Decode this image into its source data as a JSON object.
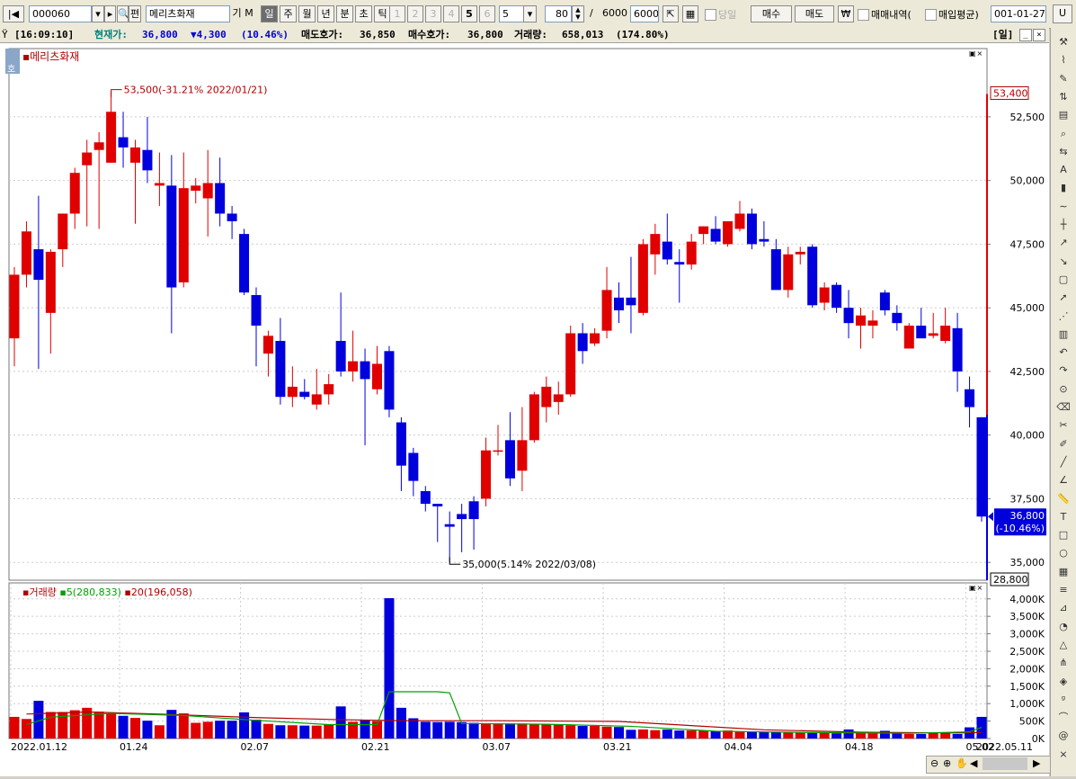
{
  "toolbar": {
    "code": "000060",
    "name": "메리츠화재",
    "btn_gi": "기",
    "btn_m": "M",
    "periods": [
      "일",
      "주",
      "월",
      "년",
      "분",
      "초",
      "틱"
    ],
    "selected_period": "일",
    "nums": [
      "1",
      "2",
      "3",
      "4",
      "5",
      "6"
    ],
    "minute_select": "5",
    "count": "80",
    "slash": "/",
    "total": "6000",
    "total_box": "6000",
    "today_label": "당일",
    "buy": "매수",
    "sell": "매도",
    "won": "₩",
    "trade_history": "매매내역(",
    "avg_price": "매입평균)",
    "date": "001-01-27"
  },
  "status": {
    "time": "[16:09:10]",
    "price_label": "현재가:",
    "price": "36,800",
    "change": "▼4,300",
    "change_pct": "(10.46%)",
    "ask_label": "매도호가:",
    "ask": "36,850",
    "bid_label": "매수호가:",
    "bid": "36,800",
    "vol_label": "거래량:",
    "volume": "658,013",
    "vol_pct": "(174.80%)",
    "period_tag": "[일]"
  },
  "chart": {
    "title": "메리츠화재",
    "tag": "호",
    "high_note": "53,500(-31.21% 2022/01/21)",
    "low_note": "35,000(5.14% 2022/03/08)",
    "max_box": "53,400",
    "min_box": "28,800",
    "current_box": "36,800",
    "current_pct": "(-10.46%)",
    "price_ticks": [
      "52,500",
      "50,000",
      "47,500",
      "45,000",
      "42,500",
      "40,000",
      "37,500",
      "35,000"
    ],
    "vol_title": "거래량",
    "ma5_label": "5(280,833)",
    "ma20_label": "20(196,058)",
    "vol_ticks": [
      "4,000K",
      "3,500K",
      "3,000K",
      "2,500K",
      "2,000K",
      "1,500K",
      "1,000K",
      "500K",
      "0K"
    ],
    "date_ticks": [
      "2022.01.12",
      "01.24",
      "02.07",
      "02.21",
      "03.07",
      "03.21",
      "04.04",
      "04.18",
      "05.02",
      "2022.05.11"
    ],
    "colors": {
      "up": "#e00000",
      "down": "#0000dd",
      "ma5": "#00a000",
      "ma20": "#b00000"
    }
  },
  "chart_data": {
    "type": "candlestick",
    "candles": [
      {
        "o": 43800,
        "h": 46600,
        "l": 42700,
        "c": 46300
      },
      {
        "o": 46300,
        "h": 48400,
        "l": 45800,
        "c": 48000
      },
      {
        "o": 47300,
        "h": 49400,
        "l": 42600,
        "c": 46100
      },
      {
        "o": 44800,
        "h": 47300,
        "l": 43200,
        "c": 47200
      },
      {
        "o": 47300,
        "h": 48600,
        "l": 46600,
        "c": 48700
      },
      {
        "o": 48700,
        "h": 50500,
        "l": 48100,
        "c": 50300
      },
      {
        "o": 50600,
        "h": 51600,
        "l": 48200,
        "c": 51100
      },
      {
        "o": 51200,
        "h": 51900,
        "l": 48100,
        "c": 51500
      },
      {
        "o": 50700,
        "h": 53500,
        "l": 50700,
        "c": 52700
      },
      {
        "o": 51700,
        "h": 52700,
        "l": 50500,
        "c": 51300
      },
      {
        "o": 50700,
        "h": 51600,
        "l": 48300,
        "c": 51300
      },
      {
        "o": 51200,
        "h": 52500,
        "l": 49900,
        "c": 50400
      },
      {
        "o": 49800,
        "h": 51100,
        "l": 49000,
        "c": 49900
      },
      {
        "o": 49800,
        "h": 51000,
        "l": 44000,
        "c": 45800
      },
      {
        "o": 46000,
        "h": 51100,
        "l": 45800,
        "c": 49700
      },
      {
        "o": 49600,
        "h": 50100,
        "l": 49100,
        "c": 49800
      },
      {
        "o": 49300,
        "h": 51200,
        "l": 47800,
        "c": 49900
      },
      {
        "o": 49900,
        "h": 50900,
        "l": 48200,
        "c": 48700
      },
      {
        "o": 48700,
        "h": 49000,
        "l": 47700,
        "c": 48400
      },
      {
        "o": 47900,
        "h": 48100,
        "l": 45500,
        "c": 45600
      },
      {
        "o": 45500,
        "h": 45800,
        "l": 42700,
        "c": 44300
      },
      {
        "o": 43200,
        "h": 44100,
        "l": 42300,
        "c": 43900
      },
      {
        "o": 43700,
        "h": 44600,
        "l": 41200,
        "c": 41500
      },
      {
        "o": 41500,
        "h": 42700,
        "l": 41100,
        "c": 41900
      },
      {
        "o": 41700,
        "h": 42200,
        "l": 41400,
        "c": 41500
      },
      {
        "o": 41200,
        "h": 42600,
        "l": 41000,
        "c": 41600
      },
      {
        "o": 41600,
        "h": 42400,
        "l": 41200,
        "c": 42000
      },
      {
        "o": 43700,
        "h": 45600,
        "l": 42300,
        "c": 42500
      },
      {
        "o": 42500,
        "h": 44100,
        "l": 42100,
        "c": 42900
      },
      {
        "o": 42900,
        "h": 43400,
        "l": 39600,
        "c": 42200
      },
      {
        "o": 41800,
        "h": 43500,
        "l": 41600,
        "c": 42800
      },
      {
        "o": 43300,
        "h": 43500,
        "l": 40700,
        "c": 41000
      },
      {
        "o": 40500,
        "h": 40700,
        "l": 37800,
        "c": 38800
      },
      {
        "o": 39300,
        "h": 39500,
        "l": 37600,
        "c": 38200
      },
      {
        "o": 37800,
        "h": 38000,
        "l": 37000,
        "c": 37300
      },
      {
        "o": 37300,
        "h": 37300,
        "l": 35800,
        "c": 37200
      },
      {
        "o": 36500,
        "h": 37000,
        "l": 35000,
        "c": 36400
      },
      {
        "o": 36900,
        "h": 37300,
        "l": 35400,
        "c": 36700
      },
      {
        "o": 37400,
        "h": 37600,
        "l": 35500,
        "c": 36700
      },
      {
        "o": 37500,
        "h": 39900,
        "l": 37200,
        "c": 39400
      },
      {
        "o": 39400,
        "h": 40400,
        "l": 39200,
        "c": 39400
      },
      {
        "o": 39800,
        "h": 40900,
        "l": 38000,
        "c": 38300
      },
      {
        "o": 38600,
        "h": 41100,
        "l": 37800,
        "c": 39800
      },
      {
        "o": 39800,
        "h": 41700,
        "l": 39700,
        "c": 41600
      },
      {
        "o": 41100,
        "h": 42300,
        "l": 40500,
        "c": 41900
      },
      {
        "o": 41300,
        "h": 42100,
        "l": 40800,
        "c": 41600
      },
      {
        "o": 41600,
        "h": 44300,
        "l": 41500,
        "c": 44000
      },
      {
        "o": 44000,
        "h": 44400,
        "l": 42800,
        "c": 43300
      },
      {
        "o": 43600,
        "h": 44200,
        "l": 43500,
        "c": 44000
      },
      {
        "o": 44100,
        "h": 46600,
        "l": 43800,
        "c": 45700
      },
      {
        "o": 45400,
        "h": 46000,
        "l": 44400,
        "c": 44900
      },
      {
        "o": 45400,
        "h": 47000,
        "l": 44000,
        "c": 45100
      },
      {
        "o": 44800,
        "h": 47700,
        "l": 44700,
        "c": 47500
      },
      {
        "o": 47100,
        "h": 48300,
        "l": 46300,
        "c": 47900
      },
      {
        "o": 47600,
        "h": 48700,
        "l": 46700,
        "c": 46900
      },
      {
        "o": 46800,
        "h": 47300,
        "l": 45200,
        "c": 46700
      },
      {
        "o": 46700,
        "h": 47900,
        "l": 46500,
        "c": 47600
      },
      {
        "o": 47900,
        "h": 48200,
        "l": 47500,
        "c": 48200
      },
      {
        "o": 48100,
        "h": 48600,
        "l": 47500,
        "c": 47600
      },
      {
        "o": 47500,
        "h": 48300,
        "l": 47400,
        "c": 48400
      },
      {
        "o": 48100,
        "h": 49200,
        "l": 48000,
        "c": 48700
      },
      {
        "o": 48700,
        "h": 48900,
        "l": 47300,
        "c": 47500
      },
      {
        "o": 47700,
        "h": 48400,
        "l": 47400,
        "c": 47600
      },
      {
        "o": 47300,
        "h": 47700,
        "l": 45900,
        "c": 45700
      },
      {
        "o": 45700,
        "h": 47400,
        "l": 45400,
        "c": 47100
      },
      {
        "o": 47100,
        "h": 47400,
        "l": 46700,
        "c": 47200
      },
      {
        "o": 47400,
        "h": 47500,
        "l": 45000,
        "c": 45100
      },
      {
        "o": 45200,
        "h": 46000,
        "l": 44900,
        "c": 45800
      },
      {
        "o": 45900,
        "h": 46000,
        "l": 44800,
        "c": 45000
      },
      {
        "o": 45000,
        "h": 45700,
        "l": 43800,
        "c": 44400
      },
      {
        "o": 44300,
        "h": 45000,
        "l": 43400,
        "c": 44700
      },
      {
        "o": 44300,
        "h": 44900,
        "l": 43800,
        "c": 44500
      },
      {
        "o": 45600,
        "h": 45700,
        "l": 44700,
        "c": 44900
      },
      {
        "o": 44800,
        "h": 45100,
        "l": 44100,
        "c": 44400
      },
      {
        "o": 43400,
        "h": 44400,
        "l": 43400,
        "c": 44300
      },
      {
        "o": 44300,
        "h": 45000,
        "l": 43900,
        "c": 43800
      },
      {
        "o": 43900,
        "h": 44800,
        "l": 43800,
        "c": 44000
      },
      {
        "o": 43700,
        "h": 45000,
        "l": 43600,
        "c": 44300
      },
      {
        "o": 44200,
        "h": 44800,
        "l": 41700,
        "c": 42500
      },
      {
        "o": 41800,
        "h": 42300,
        "l": 40300,
        "c": 41100
      },
      {
        "o": 40700,
        "h": 40700,
        "l": 36600,
        "c": 36800
      }
    ],
    "volume_k": [
      620,
      560,
      1080,
      760,
      760,
      810,
      880,
      770,
      720,
      650,
      590,
      510,
      380,
      820,
      720,
      450,
      480,
      510,
      510,
      750,
      540,
      420,
      380,
      380,
      370,
      370,
      400,
      920,
      480,
      520,
      500,
      4020,
      880,
      580,
      480,
      470,
      480,
      470,
      450,
      440,
      430,
      430,
      430,
      420,
      410,
      400,
      380,
      360,
      360,
      340,
      330,
      250,
      260,
      240,
      260,
      230,
      230,
      220,
      210,
      230,
      200,
      190,
      190,
      180,
      170,
      180,
      170,
      160,
      150,
      260,
      160,
      150,
      220,
      150,
      130,
      130,
      170,
      170,
      130,
      320,
      620
    ],
    "ma5_k": [
      [
        1,
        400
      ],
      [
        3,
        610
      ],
      [
        8,
        720
      ],
      [
        14,
        660
      ],
      [
        20,
        520
      ],
      [
        26,
        400
      ],
      [
        30,
        400
      ],
      [
        31,
        1340
      ],
      [
        35,
        1340
      ],
      [
        36,
        1310
      ],
      [
        37,
        430
      ],
      [
        44,
        410
      ],
      [
        51,
        350
      ],
      [
        58,
        210
      ],
      [
        66,
        170
      ],
      [
        74,
        150
      ],
      [
        79,
        190
      ],
      [
        80,
        320
      ]
    ],
    "ma20_k": [
      [
        1,
        700
      ],
      [
        6,
        760
      ],
      [
        12,
        700
      ],
      [
        20,
        600
      ],
      [
        27,
        540
      ],
      [
        32,
        510
      ],
      [
        40,
        510
      ],
      [
        50,
        490
      ],
      [
        62,
        250
      ],
      [
        70,
        180
      ],
      [
        78,
        160
      ],
      [
        80,
        170
      ]
    ],
    "price_range": [
      34300,
      54900
    ],
    "volume_range_k": [
      0,
      4200
    ]
  },
  "sidebar": {
    "icons": [
      "tool-icon",
      "line-chart-icon",
      "pen-icon",
      "price-icon",
      "chart-icon",
      "search-chart-icon",
      "compare-icon",
      "auto-icon",
      "bar-icon",
      "line-icon",
      "candle-icon",
      "rise-icon",
      "fall-icon",
      "box-icon",
      "arrow-icon",
      "line-compare-icon",
      "hist-icon",
      "undo-icon",
      "redo-icon",
      "magnifier-icon",
      "eraser-icon",
      "cut-icon",
      "pencil-icon",
      "line-draw-icon",
      "angle-icon",
      "ruler-icon",
      "text-icon",
      "rect-icon",
      "circle-icon",
      "grid-icon",
      "fib-icon",
      "gann-icon",
      "cycle-icon",
      "triangle-icon",
      "pitchfork-icon",
      "all-icon",
      "zigzag-icon",
      "curve-icon",
      "spiral-icon",
      "cross-icon"
    ]
  }
}
